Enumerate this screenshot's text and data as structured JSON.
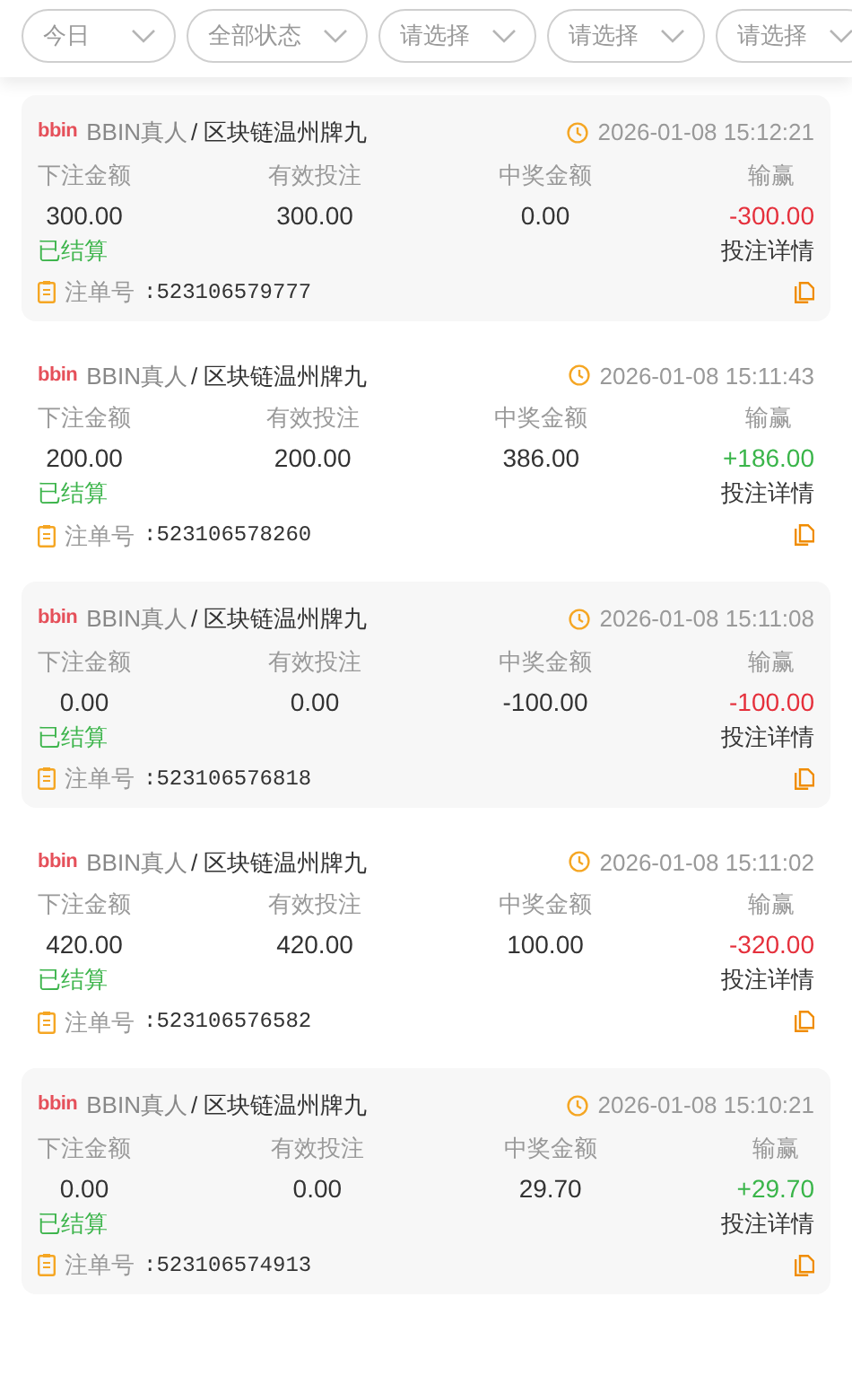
{
  "filters": [
    {
      "label": "今日"
    },
    {
      "label": "全部状态"
    },
    {
      "label": "请选择"
    },
    {
      "label": "请选择"
    },
    {
      "label": "请选择"
    }
  ],
  "records": [
    {
      "logo": "bbin",
      "platform": "BBIN真人",
      "game": "/ 区块链温州牌九",
      "time": "2026-01-08 15:12:21",
      "labels": [
        "下注金额",
        "有效投注",
        "中奖金额",
        "输赢"
      ],
      "bet": "300.00",
      "valid": "300.00",
      "payout": "0.00",
      "result": {
        "text": "-300.00",
        "kind": "loss"
      },
      "status": {
        "text": "已结算",
        "kind": "settled"
      },
      "detail_link": "投注详情",
      "bet_no_label": "注单号",
      "bet_no": ":523106579777"
    },
    {
      "logo": "bbin",
      "platform": "BBIN真人",
      "game": "/ 区块链温州牌九",
      "time": "2026-01-08 15:11:43",
      "labels": [
        "下注金额",
        "有效投注",
        "中奖金额",
        "输赢"
      ],
      "bet": "200.00",
      "valid": "200.00",
      "payout": "386.00",
      "result": {
        "text": "+186.00",
        "kind": "win"
      },
      "status": {
        "text": "已结算",
        "kind": "settled"
      },
      "detail_link": "投注详情",
      "bet_no_label": "注单号",
      "bet_no": ":523106578260"
    },
    {
      "logo": "bbin",
      "platform": "BBIN真人",
      "game": "/ 区块链温州牌九",
      "time": "2026-01-08 15:11:08",
      "labels": [
        "下注金额",
        "有效投注",
        "中奖金额",
        "输赢"
      ],
      "bet": "0.00",
      "valid": "0.00",
      "payout": "-100.00",
      "result": {
        "text": "-100.00",
        "kind": "loss"
      },
      "status": {
        "text": "已结算",
        "kind": "settled"
      },
      "detail_link": "投注详情",
      "bet_no_label": "注单号",
      "bet_no": ":523106576818"
    },
    {
      "logo": "bbin",
      "platform": "BBIN真人",
      "game": "/ 区块链温州牌九",
      "time": "2026-01-08 15:11:02",
      "labels": [
        "下注金额",
        "有效投注",
        "中奖金额",
        "输赢"
      ],
      "bet": "420.00",
      "valid": "420.00",
      "payout": "100.00",
      "result": {
        "text": "-320.00",
        "kind": "loss"
      },
      "status": {
        "text": "已结算",
        "kind": "settled"
      },
      "detail_link": "投注详情",
      "bet_no_label": "注单号",
      "bet_no": ":523106576582"
    },
    {
      "logo": "bbin",
      "platform": "BBIN真人",
      "game": "/ 区块链温州牌九",
      "time": "2026-01-08 15:10:21",
      "labels": [
        "下注金额",
        "有效投注",
        "中奖金额",
        "输赢"
      ],
      "bet": "0.00",
      "valid": "0.00",
      "payout": "29.70",
      "result": {
        "text": "+29.70",
        "kind": "win"
      },
      "status": {
        "text": "已结算",
        "kind": "settled"
      },
      "detail_link": "投注详情",
      "bet_no_label": "注单号",
      "bet_no": ":523106574913"
    }
  ]
}
